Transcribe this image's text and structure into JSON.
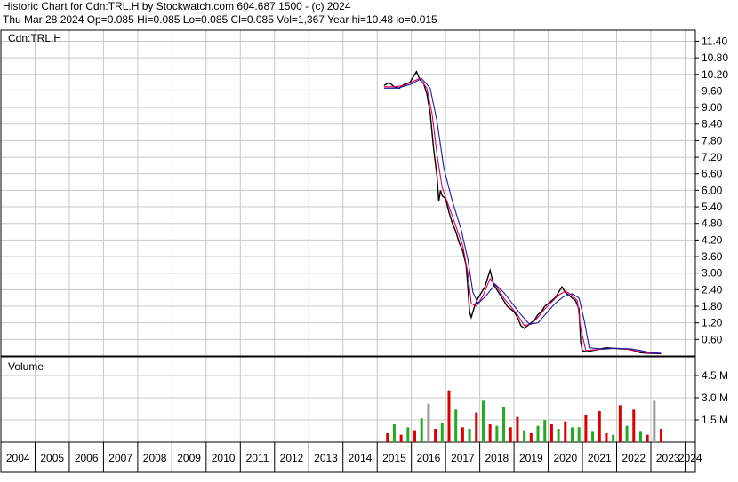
{
  "header": {
    "line1": "Historic Chart for Cdn:TRL.H by Stockwatch.com 604.687.1500 - (c) 2024",
    "line2": "Thu Mar 28 2024   Op=0.085   Hi=0.085   Lo=0.085   Cl=0.085   Vol=1,367   Year hi=10.48   lo=0.015"
  },
  "colors": {
    "grid": "#c8c8c8",
    "price": "#000000",
    "ma_short": "#e0005a",
    "ma_long": "#1a1aaa",
    "vol_up": "#22aa22",
    "vol_down": "#dd0000",
    "vol_flat": "#999999"
  },
  "chart_data": [
    {
      "type": "line",
      "title": "Cdn:TRL.H",
      "ylabel": "",
      "xlabel": "",
      "ylim": [
        0,
        11.8
      ],
      "xlim": [
        2004,
        2024.3
      ],
      "y_ticks": [
        "11.40",
        "10.80",
        "10.20",
        "9.60",
        "9.00",
        "8.40",
        "7.80",
        "7.20",
        "6.60",
        "6.00",
        "5.40",
        "4.80",
        "4.20",
        "3.60",
        "3.00",
        "2.40",
        "1.80",
        "1.20",
        "0.60"
      ],
      "x_ticks": [
        "2004",
        "2005",
        "2006",
        "2007",
        "2008",
        "2009",
        "2010",
        "2011",
        "2012",
        "2013",
        "2014",
        "2015",
        "2016",
        "2017",
        "2018",
        "2019",
        "2020",
        "2021",
        "2022",
        "2023",
        "2024"
      ],
      "grid": true,
      "series": [
        {
          "style": "price",
          "points": [
            [
              2015.2,
              9.8
            ],
            [
              2015.35,
              9.9
            ],
            [
              2015.5,
              9.75
            ],
            [
              2015.65,
              9.7
            ],
            [
              2015.8,
              9.85
            ],
            [
              2015.95,
              9.9
            ],
            [
              2016.05,
              10.1
            ],
            [
              2016.15,
              10.3
            ],
            [
              2016.25,
              10.0
            ],
            [
              2016.35,
              9.9
            ],
            [
              2016.45,
              9.5
            ],
            [
              2016.55,
              8.8
            ],
            [
              2016.65,
              7.5
            ],
            [
              2016.75,
              6.5
            ],
            [
              2016.8,
              5.6
            ],
            [
              2016.85,
              6.0
            ],
            [
              2016.9,
              5.8
            ],
            [
              2017.0,
              5.7
            ],
            [
              2017.1,
              5.2
            ],
            [
              2017.2,
              4.8
            ],
            [
              2017.3,
              4.5
            ],
            [
              2017.4,
              4.1
            ],
            [
              2017.5,
              3.8
            ],
            [
              2017.6,
              3.3
            ],
            [
              2017.65,
              2.5
            ],
            [
              2017.7,
              1.6
            ],
            [
              2017.75,
              1.4
            ],
            [
              2017.85,
              1.8
            ],
            [
              2017.95,
              2.1
            ],
            [
              2018.05,
              2.3
            ],
            [
              2018.15,
              2.5
            ],
            [
              2018.25,
              2.9
            ],
            [
              2018.3,
              3.1
            ],
            [
              2018.4,
              2.6
            ],
            [
              2018.5,
              2.4
            ],
            [
              2018.6,
              2.2
            ],
            [
              2018.7,
              2.0
            ],
            [
              2018.8,
              1.8
            ],
            [
              2018.9,
              1.7
            ],
            [
              2019.0,
              1.6
            ],
            [
              2019.1,
              1.4
            ],
            [
              2019.2,
              1.1
            ],
            [
              2019.3,
              1.0
            ],
            [
              2019.4,
              1.1
            ],
            [
              2019.5,
              1.2
            ],
            [
              2019.6,
              1.3
            ],
            [
              2019.7,
              1.5
            ],
            [
              2019.8,
              1.6
            ],
            [
              2019.9,
              1.8
            ],
            [
              2020.0,
              1.9
            ],
            [
              2020.1,
              2.0
            ],
            [
              2020.2,
              2.1
            ],
            [
              2020.3,
              2.3
            ],
            [
              2020.4,
              2.5
            ],
            [
              2020.5,
              2.3
            ],
            [
              2020.6,
              2.2
            ],
            [
              2020.7,
              2.1
            ],
            [
              2020.8,
              2.0
            ],
            [
              2020.9,
              1.7
            ],
            [
              2020.95,
              0.5
            ],
            [
              2021.0,
              0.2
            ],
            [
              2021.1,
              0.15
            ],
            [
              2021.3,
              0.2
            ],
            [
              2021.5,
              0.25
            ],
            [
              2021.7,
              0.3
            ],
            [
              2021.9,
              0.28
            ],
            [
              2022.1,
              0.26
            ],
            [
              2022.3,
              0.25
            ],
            [
              2022.5,
              0.2
            ],
            [
              2022.7,
              0.12
            ],
            [
              2022.9,
              0.1
            ],
            [
              2023.1,
              0.09
            ],
            [
              2023.3,
              0.085
            ]
          ]
        },
        {
          "style": "ma_short",
          "points": [
            [
              2015.2,
              9.75
            ],
            [
              2015.5,
              9.75
            ],
            [
              2015.8,
              9.8
            ],
            [
              2016.05,
              9.95
            ],
            [
              2016.25,
              10.05
            ],
            [
              2016.45,
              9.7
            ],
            [
              2016.6,
              8.8
            ],
            [
              2016.75,
              7.3
            ],
            [
              2016.9,
              6.1
            ],
            [
              2017.1,
              5.4
            ],
            [
              2017.3,
              4.7
            ],
            [
              2017.5,
              4.0
            ],
            [
              2017.65,
              3.0
            ],
            [
              2017.75,
              1.9
            ],
            [
              2017.9,
              1.8
            ],
            [
              2018.1,
              2.2
            ],
            [
              2018.3,
              2.8
            ],
            [
              2018.5,
              2.5
            ],
            [
              2018.7,
              2.1
            ],
            [
              2018.9,
              1.8
            ],
            [
              2019.1,
              1.5
            ],
            [
              2019.3,
              1.1
            ],
            [
              2019.5,
              1.15
            ],
            [
              2019.7,
              1.4
            ],
            [
              2019.9,
              1.7
            ],
            [
              2020.1,
              1.95
            ],
            [
              2020.3,
              2.2
            ],
            [
              2020.5,
              2.35
            ],
            [
              2020.7,
              2.2
            ],
            [
              2020.85,
              2.0
            ],
            [
              2020.95,
              1.0
            ],
            [
              2021.1,
              0.2
            ],
            [
              2021.5,
              0.24
            ],
            [
              2021.9,
              0.28
            ],
            [
              2022.3,
              0.25
            ],
            [
              2022.6,
              0.18
            ],
            [
              2022.9,
              0.11
            ],
            [
              2023.3,
              0.09
            ]
          ]
        },
        {
          "style": "ma_long",
          "points": [
            [
              2015.2,
              9.7
            ],
            [
              2015.6,
              9.7
            ],
            [
              2016.0,
              9.85
            ],
            [
              2016.3,
              10.05
            ],
            [
              2016.55,
              9.7
            ],
            [
              2016.75,
              8.5
            ],
            [
              2016.95,
              6.8
            ],
            [
              2017.2,
              5.6
            ],
            [
              2017.45,
              4.6
            ],
            [
              2017.65,
              3.5
            ],
            [
              2017.8,
              2.3
            ],
            [
              2017.95,
              1.9
            ],
            [
              2018.2,
              2.2
            ],
            [
              2018.45,
              2.6
            ],
            [
              2018.7,
              2.3
            ],
            [
              2018.95,
              1.9
            ],
            [
              2019.2,
              1.5
            ],
            [
              2019.45,
              1.15
            ],
            [
              2019.7,
              1.2
            ],
            [
              2019.95,
              1.55
            ],
            [
              2020.2,
              1.9
            ],
            [
              2020.45,
              2.15
            ],
            [
              2020.7,
              2.25
            ],
            [
              2020.9,
              2.1
            ],
            [
              2021.05,
              1.3
            ],
            [
              2021.2,
              0.3
            ],
            [
              2021.6,
              0.25
            ],
            [
              2022.0,
              0.28
            ],
            [
              2022.4,
              0.26
            ],
            [
              2022.7,
              0.2
            ],
            [
              2023.0,
              0.12
            ],
            [
              2023.3,
              0.1
            ]
          ]
        }
      ]
    },
    {
      "type": "bar",
      "title": "Volume",
      "ylim": [
        0,
        5.4
      ],
      "y_ticks": [
        "4.5 M",
        "3.0 M",
        "1.5 M"
      ],
      "y_tick_values": [
        4.5,
        3.0,
        1.5
      ],
      "x": [
        2015.3,
        2015.5,
        2015.7,
        2015.9,
        2016.1,
        2016.3,
        2016.5,
        2016.7,
        2016.9,
        2017.1,
        2017.3,
        2017.5,
        2017.7,
        2017.9,
        2018.1,
        2018.3,
        2018.5,
        2018.7,
        2018.9,
        2019.1,
        2019.3,
        2019.5,
        2019.7,
        2019.9,
        2020.1,
        2020.3,
        2020.5,
        2020.7,
        2020.9,
        2021.1,
        2021.3,
        2021.5,
        2021.7,
        2021.9,
        2022.1,
        2022.3,
        2022.5,
        2022.7,
        2022.9,
        2023.1,
        2023.3
      ],
      "values": [
        0.6,
        1.2,
        0.5,
        1.0,
        0.8,
        1.6,
        2.6,
        0.9,
        1.3,
        3.5,
        2.2,
        1.0,
        0.9,
        2.0,
        2.8,
        1.2,
        1.1,
        2.4,
        1.0,
        1.7,
        0.8,
        0.6,
        1.1,
        1.5,
        1.2,
        0.9,
        1.4,
        1.0,
        1.0,
        1.8,
        0.7,
        2.1,
        0.6,
        0.5,
        2.5,
        1.1,
        2.2,
        0.7,
        0.5,
        2.8,
        0.9
      ],
      "directions": [
        "down",
        "up",
        "down",
        "up",
        "down",
        "up",
        "flat",
        "down",
        "up",
        "down",
        "up",
        "down",
        "up",
        "down",
        "up",
        "down",
        "up",
        "up",
        "down",
        "down",
        "up",
        "down",
        "up",
        "up",
        "down",
        "up",
        "down",
        "up",
        "up",
        "down",
        "up",
        "down",
        "down",
        "up",
        "down",
        "up",
        "down",
        "up",
        "down",
        "flat",
        "down"
      ]
    }
  ]
}
